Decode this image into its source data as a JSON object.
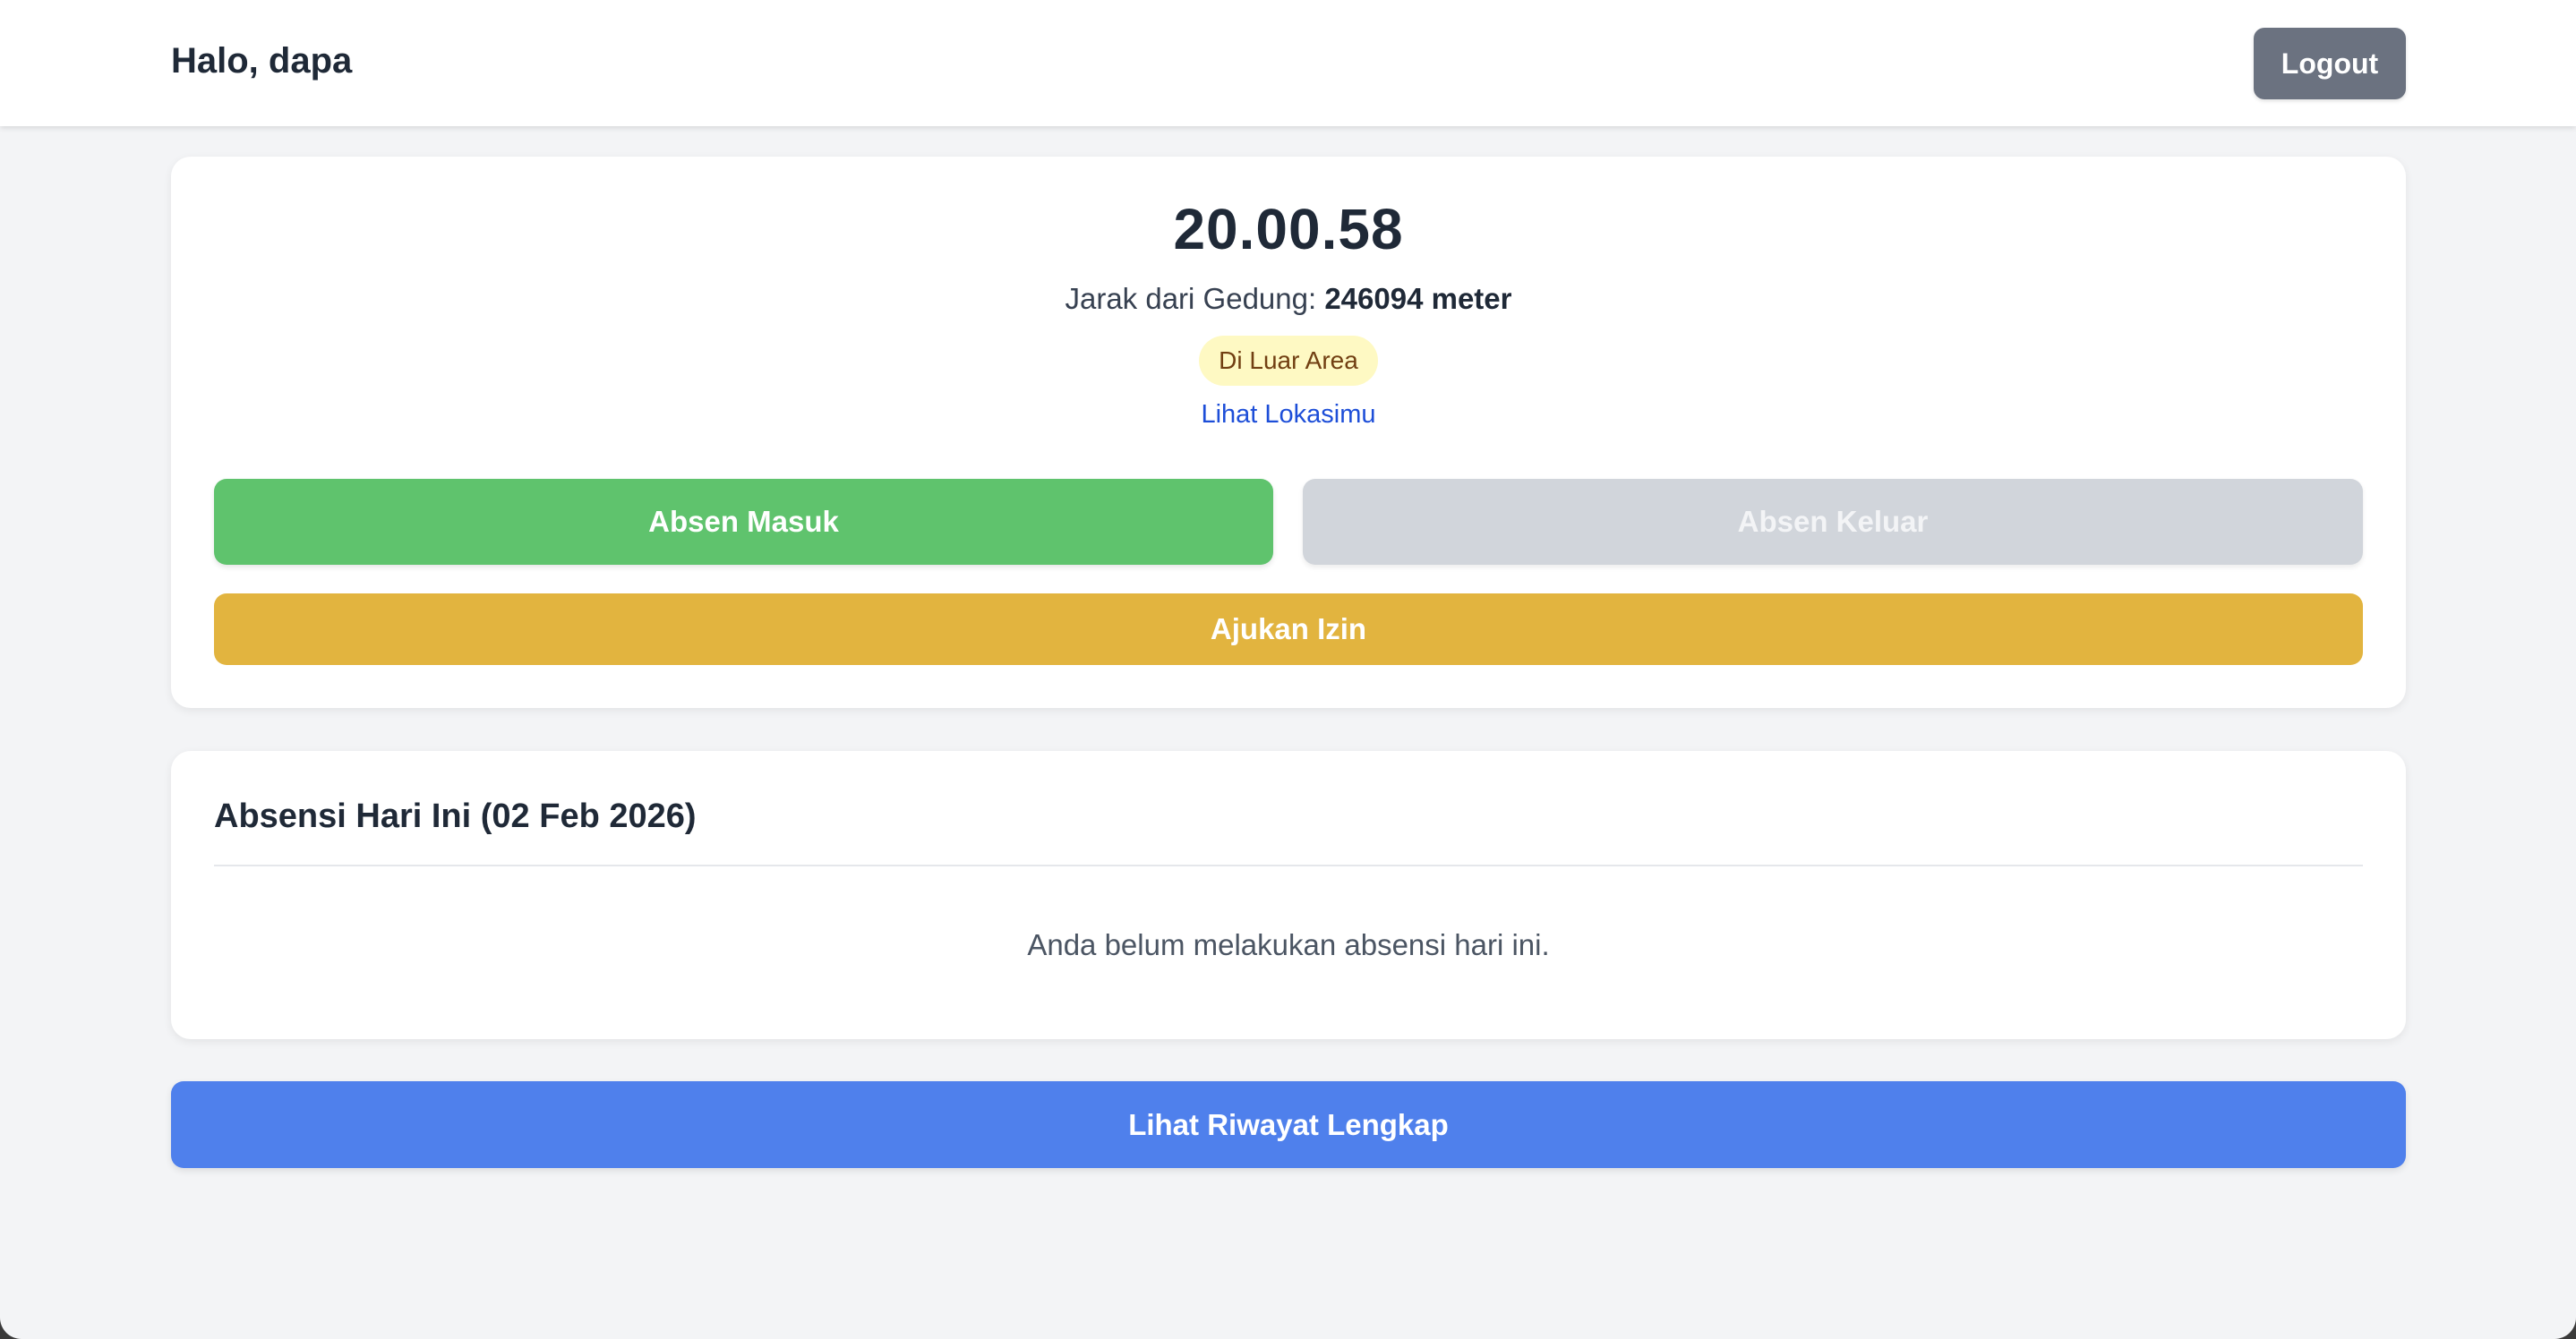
{
  "header": {
    "greeting": "Halo, dapa",
    "logout_label": "Logout"
  },
  "status": {
    "clock": "20.00.58",
    "distance_label": "Jarak dari Gedung:",
    "distance_value": "246094 meter",
    "area_badge": "Di Luar Area",
    "location_link": "Lihat Lokasimu",
    "check_in_label": "Absen Masuk",
    "check_out_label": "Absen Keluar",
    "leave_label": "Ajukan Izin"
  },
  "today": {
    "title": "Absensi Hari Ini (02 Feb 2026)",
    "empty_message": "Anda belum melakukan absensi hari ini."
  },
  "history": {
    "button_label": "Lihat Riwayat Lengkap"
  },
  "colors": {
    "check_in": "#5fc36d",
    "check_out_disabled": "#d1d5db",
    "leave": "#e2b43f",
    "history": "#4f80ec",
    "logout": "#6b7280",
    "badge_bg": "#fef9c3",
    "link": "#1d4ed8"
  }
}
